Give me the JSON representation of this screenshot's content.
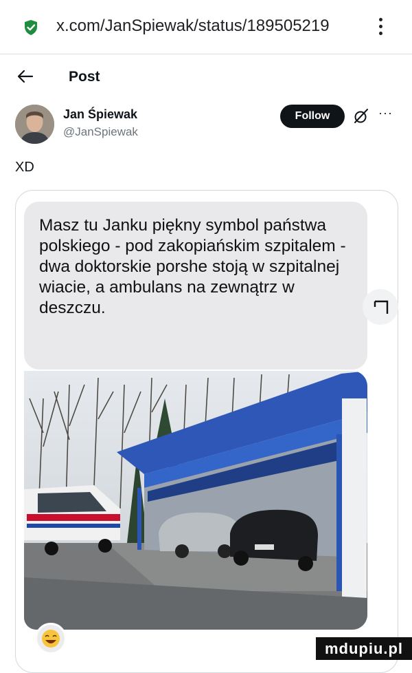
{
  "browser": {
    "url": "x.com/JanSpiewak/status/189505219",
    "icons": {
      "security": "shield-check-icon",
      "menu": "kebab-menu-icon"
    },
    "colors": {
      "security": "#1e8e3e"
    }
  },
  "header": {
    "title": "Post",
    "back_icon": "arrow-left-icon"
  },
  "author": {
    "name": "Jan Śpiewak",
    "handle": "@JanSpiewak",
    "follow_label": "Follow",
    "icons": [
      "grok-icon",
      "more-options-icon"
    ]
  },
  "tweet": {
    "text": "XD",
    "message": "Masz tu Janku piękny symbol państwa polskiego - pod zakopiańskim szpitalem - dwa doktorskie porshe stoją w szpitalnej wiacie, a ambulans na zewnątrz w deszczu.",
    "reaction_icon": "laughing-emoji-icon",
    "share_icon": "share-icon"
  },
  "watermark": "mdupiu.pl"
}
